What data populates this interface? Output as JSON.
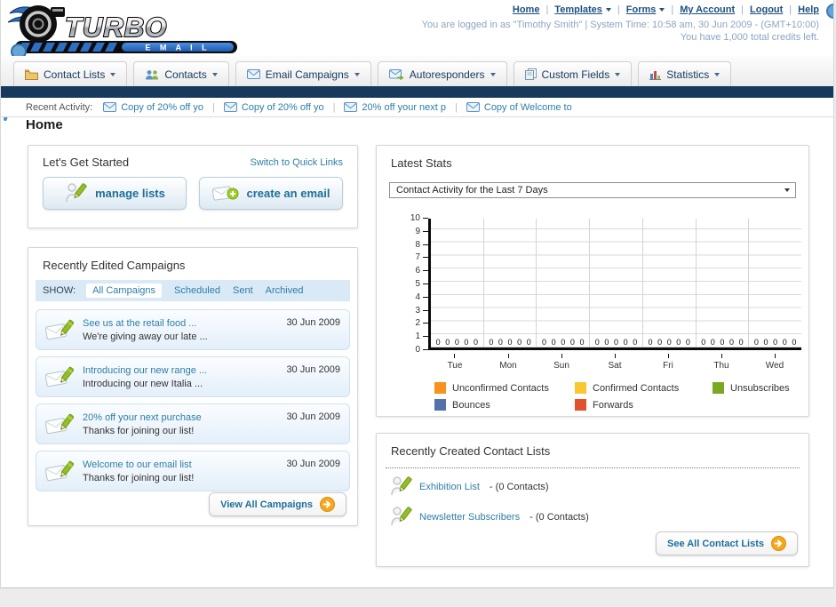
{
  "brand": {
    "name": "TURBO",
    "sub": "E M A I L"
  },
  "header": {
    "links": [
      {
        "label": "Home",
        "caret": false
      },
      {
        "label": "Templates",
        "caret": true
      },
      {
        "label": "Forms",
        "caret": true
      },
      {
        "label": "My Account",
        "caret": false
      },
      {
        "label": "Logout",
        "caret": false
      },
      {
        "label": "Help",
        "caret": false
      }
    ],
    "login_info": "You are logged in as \"Timothy Smith\" | System Time: 10:58 am, 30 Jun 2009 - (GMT+10:00)",
    "credits_info": "You have 1,000 total credits left."
  },
  "nav": {
    "tabs": [
      {
        "label": "Contact Lists",
        "icon": "folder-icon"
      },
      {
        "label": "Contacts",
        "icon": "contacts-icon"
      },
      {
        "label": "Email Campaigns",
        "icon": "envelope-icon"
      },
      {
        "label": "Autoresponders",
        "icon": "envelope-arrow-icon"
      },
      {
        "label": "Custom Fields",
        "icon": "pages-icon"
      },
      {
        "label": "Statistics",
        "icon": "chart-icon"
      }
    ]
  },
  "activity": {
    "label": "Recent Activity:",
    "items": [
      "Copy of 20% off yo",
      "Copy of 20% off yo",
      "20% off your next p",
      "Copy of Welcome to"
    ]
  },
  "page": {
    "title": "Home"
  },
  "get_started": {
    "title": "Let's Get Started",
    "switch_link": "Switch to Quick Links",
    "buttons": [
      {
        "label": "manage lists",
        "icon": "person-pencil-icon"
      },
      {
        "label": "create an email",
        "icon": "envelope-plus-icon"
      }
    ]
  },
  "campaigns": {
    "title": "Recently Edited Campaigns",
    "show_label": "SHOW:",
    "filters": [
      {
        "label": "All Campaigns",
        "active": true
      },
      {
        "label": "Scheduled",
        "active": false
      },
      {
        "label": "Sent",
        "active": false
      },
      {
        "label": "Archived",
        "active": false
      }
    ],
    "items": [
      {
        "title": "See us at the retail food ...",
        "subtitle": "We're giving away our late ...",
        "date": "30 Jun 2009"
      },
      {
        "title": "Introducing our new range ...",
        "subtitle": "Introducing our new Italia ...",
        "date": "30 Jun 2009"
      },
      {
        "title": "20% off your next purchase",
        "subtitle": "Thanks for joining our list!",
        "date": "30 Jun 2009"
      },
      {
        "title": "Welcome to our email list",
        "subtitle": "Thanks for joining our list!",
        "date": "30 Jun 2009"
      }
    ],
    "view_all_label": "View All Campaigns"
  },
  "stats": {
    "title": "Latest Stats",
    "dropdown_value": "Contact Activity for the Last 7 Days"
  },
  "chart_data": {
    "type": "bar",
    "title": "Contact Activity for the Last 7 Days",
    "categories": [
      "Tue",
      "Mon",
      "Sun",
      "Sat",
      "Fri",
      "Thu",
      "Wed"
    ],
    "series": [
      {
        "name": "Unconfirmed Contacts",
        "color": "#f6921e",
        "values": [
          0,
          0,
          0,
          0,
          0,
          0,
          0
        ]
      },
      {
        "name": "Confirmed Contacts",
        "color": "#f8c732",
        "values": [
          0,
          0,
          0,
          0,
          0,
          0,
          0
        ]
      },
      {
        "name": "Unsubscribes",
        "color": "#7aa825",
        "values": [
          0,
          0,
          0,
          0,
          0,
          0,
          0
        ]
      },
      {
        "name": "Bounces",
        "color": "#5471a9",
        "values": [
          0,
          0,
          0,
          0,
          0,
          0,
          0
        ]
      },
      {
        "name": "Forwards",
        "color": "#e2512e",
        "values": [
          0,
          0,
          0,
          0,
          0,
          0,
          0
        ]
      }
    ],
    "xlabel": "",
    "ylabel": "",
    "ylim": [
      0,
      10
    ],
    "ytick_step": 1,
    "grid": true,
    "legend_position": "bottom"
  },
  "contact_lists": {
    "title": "Recently Created Contact Lists",
    "items": [
      {
        "name": "Exhibition List",
        "suffix": "- (0 Contacts)"
      },
      {
        "name": "Newsletter Subscribers",
        "suffix": "- (0 Contacts)"
      }
    ],
    "see_all_label": "See All Contact Lists"
  },
  "colors": {
    "navy_bar": "#16395c",
    "link_teal": "#2e7ea6",
    "header_link": "#1c5180",
    "button_text": "#1d6f99",
    "arrow_button": "#f5a71d",
    "filter_bar_bg": "#d9e9f6"
  }
}
